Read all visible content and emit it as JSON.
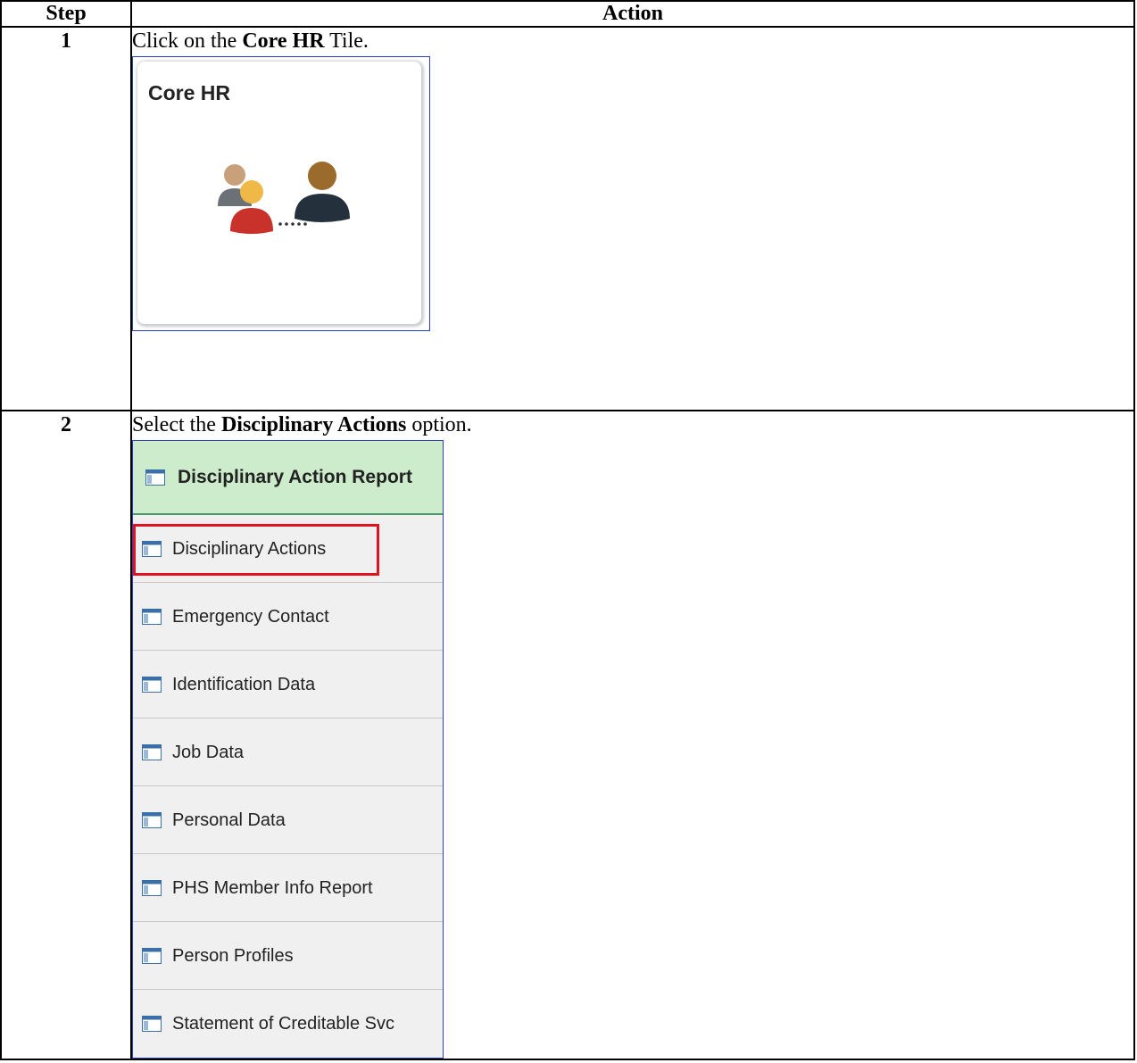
{
  "table": {
    "header_step": "Step",
    "header_action": "Action"
  },
  "steps": [
    {
      "number": "1",
      "instruction_pre": "Click on the ",
      "instruction_bold": "Core HR",
      "instruction_post": " Tile.",
      "tile": {
        "title": "Core HR",
        "icon": "people-connection-icon"
      }
    },
    {
      "number": "2",
      "instruction_pre": "Select the ",
      "instruction_bold": "Disciplinary Actions",
      "instruction_post": " option.",
      "menu": {
        "header": "Disciplinary Action Report",
        "items": [
          "Disciplinary Actions",
          "Emergency Contact",
          "Identification Data",
          "Job Data",
          "Personal Data",
          "PHS Member Info Report",
          "Person Profiles",
          "Statement of Creditable Svc"
        ],
        "highlighted_item": "Disciplinary Actions",
        "item_icon": "page-icon",
        "highlight_color": "#e0141e",
        "header_color": "#cceccc"
      }
    }
  ]
}
